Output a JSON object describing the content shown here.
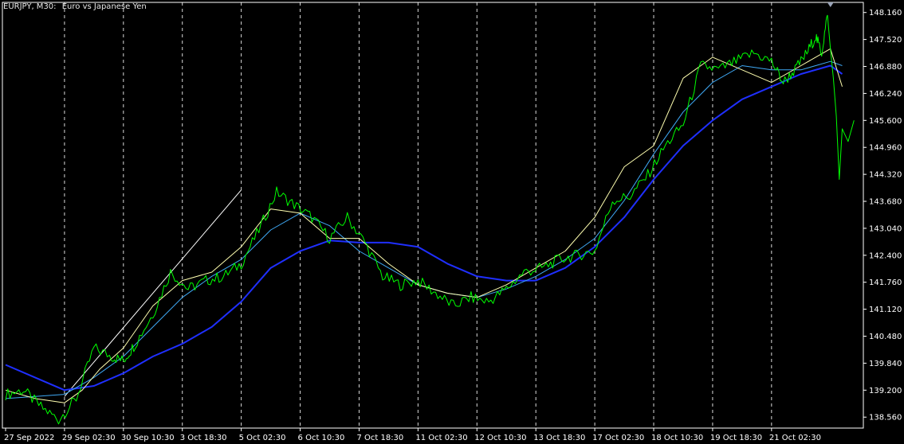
{
  "header": {
    "symbol": "EURJPY, M30:",
    "description": "Euro vs Japanese Yen"
  },
  "colors": {
    "background": "#000000",
    "price": "#00ff00",
    "ma_fast": "#ffffb0",
    "ma_mid": "#3fa9f5",
    "ma_slow": "#1f2fff",
    "grid": "#ffffff",
    "axis": "#ffffff",
    "trendline": "#ffffff"
  },
  "chart_data": {
    "type": "line",
    "title": "",
    "xlabel": "",
    "ylabel": "",
    "ylim": [
      138.3,
      148.4
    ],
    "grid": true,
    "y_ticks": [
      "148.160",
      "147.520",
      "146.880",
      "146.240",
      "145.600",
      "144.960",
      "144.320",
      "143.680",
      "143.040",
      "142.400",
      "141.760",
      "141.120",
      "140.480",
      "139.840",
      "139.200",
      "138.560"
    ],
    "x_ticks": [
      "27 Sep 2022",
      "29 Sep 02:30",
      "30 Sep 10:30",
      "3 Oct 18:30",
      "5 Oct 02:30",
      "6 Oct 10:30",
      "7 Oct 18:30",
      "11 Oct 02:30",
      "12 Oct 10:30",
      "13 Oct 18:30",
      "17 Oct 02:30",
      "18 Oct 10:30",
      "19 Oct 18:30",
      "21 Oct 02:30"
    ],
    "series": [
      {
        "key": "price",
        "color": "#00ff00",
        "width": 1,
        "x": [
          0,
          0.3,
          0.6,
          0.9,
          1.2,
          1.5,
          1.8,
          2.0,
          2.2,
          2.5,
          2.8,
          3.1,
          3.4,
          3.7,
          4.0,
          4.3,
          4.6,
          4.9,
          5.2,
          5.5,
          5.8,
          6.1,
          6.4,
          6.7,
          7.0,
          7.3,
          7.6,
          7.9,
          8.2,
          8.5,
          8.8,
          9.1,
          9.4,
          9.7,
          10.0,
          10.3,
          10.6,
          10.9,
          11.2,
          11.5,
          11.8,
          12.1,
          12.4,
          12.7,
          13.0,
          13.2,
          13.4,
          13.6,
          13.75,
          13.85,
          13.95
        ],
        "y": [
          139.1,
          139.2,
          138.8,
          138.5,
          139.0,
          140.2,
          140.0,
          139.9,
          140.3,
          141.0,
          142.0,
          141.6,
          141.8,
          141.9,
          142.2,
          143.0,
          143.9,
          143.6,
          143.3,
          142.8,
          143.3,
          142.7,
          141.9,
          141.7,
          141.8,
          141.5,
          141.2,
          141.4,
          141.3,
          141.6,
          142.0,
          142.1,
          142.3,
          142.4,
          142.5,
          143.7,
          143.8,
          144.3,
          145.0,
          145.5,
          146.9,
          146.8,
          147.0,
          147.2,
          147.0,
          146.5,
          146.8,
          147.2,
          147.6,
          147.2,
          148.1
        ]
      },
      {
        "key": "price_spike",
        "color": "#00ff00",
        "width": 1,
        "x": [
          13.95,
          14.0,
          14.05,
          14.1,
          14.15,
          14.2,
          14.3,
          14.4
        ],
        "y": [
          148.1,
          147.3,
          146.6,
          145.7,
          144.2,
          145.4,
          145.1,
          145.6
        ]
      },
      {
        "key": "ma_fast",
        "color": "#ffffb0",
        "width": 1,
        "x": [
          0,
          0.5,
          1.0,
          1.3,
          1.6,
          2.0,
          2.5,
          3.0,
          3.5,
          4.0,
          4.5,
          5.0,
          5.5,
          6.0,
          6.5,
          7.0,
          7.5,
          8.0,
          8.5,
          9.0,
          9.5,
          10.0,
          10.5,
          11.0,
          11.5,
          12.0,
          12.5,
          13.0,
          13.5,
          14.0,
          14.2
        ],
        "y": [
          139.2,
          139.0,
          138.9,
          139.2,
          139.7,
          140.2,
          141.2,
          141.8,
          142.0,
          142.6,
          143.5,
          143.4,
          142.8,
          142.8,
          142.2,
          141.7,
          141.5,
          141.4,
          141.7,
          142.1,
          142.5,
          143.3,
          144.5,
          145.0,
          146.6,
          147.1,
          146.8,
          146.5,
          146.9,
          147.3,
          146.4
        ]
      },
      {
        "key": "ma_mid",
        "color": "#3fa9f5",
        "width": 1,
        "x": [
          0,
          1.0,
          1.5,
          2.0,
          2.5,
          3.0,
          3.5,
          4.0,
          4.5,
          5.0,
          5.5,
          6.0,
          6.5,
          7.0,
          7.5,
          8.0,
          8.5,
          9.0,
          9.5,
          10.0,
          10.5,
          11.0,
          11.5,
          12.0,
          12.5,
          13.0,
          13.5,
          14.0,
          14.2
        ],
        "y": [
          139.0,
          139.1,
          139.5,
          140.0,
          140.7,
          141.4,
          141.9,
          142.3,
          143.0,
          143.4,
          143.1,
          142.5,
          142.1,
          141.7,
          141.5,
          141.4,
          141.6,
          141.9,
          142.3,
          142.8,
          143.7,
          144.8,
          145.8,
          146.5,
          146.9,
          146.8,
          146.8,
          147.0,
          146.9
        ]
      },
      {
        "key": "ma_slow",
        "color": "#1f2fff",
        "width": 2,
        "x": [
          0,
          0.5,
          1.0,
          1.5,
          2.0,
          2.5,
          3.0,
          3.5,
          4.0,
          4.5,
          5.0,
          5.5,
          6.0,
          6.5,
          7.0,
          7.5,
          8.0,
          8.5,
          9.0,
          9.5,
          10.0,
          10.5,
          11.0,
          11.5,
          12.0,
          12.5,
          13.0,
          13.5,
          14.0,
          14.2
        ],
        "y": [
          139.8,
          139.5,
          139.2,
          139.3,
          139.6,
          140.0,
          140.3,
          140.7,
          141.3,
          142.1,
          142.5,
          142.75,
          142.7,
          142.7,
          142.6,
          142.2,
          141.9,
          141.8,
          141.8,
          142.1,
          142.6,
          143.3,
          144.2,
          145.0,
          145.6,
          146.1,
          146.4,
          146.7,
          146.9,
          146.7
        ]
      }
    ],
    "trendline": {
      "x": [
        1.0,
        4.0
      ],
      "y": [
        139.05,
        143.95
      ]
    }
  }
}
